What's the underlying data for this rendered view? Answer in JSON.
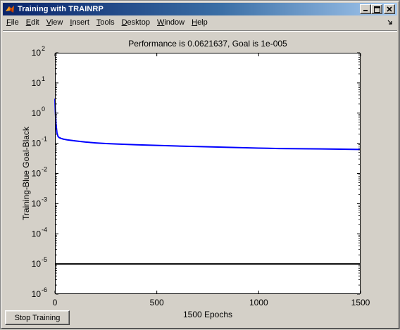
{
  "window": {
    "title": "Training with TRAINRP",
    "controls": [
      "minimize",
      "maximize",
      "close"
    ]
  },
  "menu": {
    "items": [
      {
        "pre": "",
        "ul": "F",
        "post": "ile"
      },
      {
        "pre": "",
        "ul": "E",
        "post": "dit"
      },
      {
        "pre": "",
        "ul": "V",
        "post": "iew"
      },
      {
        "pre": "",
        "ul": "I",
        "post": "nsert"
      },
      {
        "pre": "",
        "ul": "T",
        "post": "ools"
      },
      {
        "pre": "",
        "ul": "D",
        "post": "esktop"
      },
      {
        "pre": "",
        "ul": "W",
        "post": "indow"
      },
      {
        "pre": "",
        "ul": "H",
        "post": "elp"
      }
    ]
  },
  "controls": {
    "stop_label": "Stop Training"
  },
  "chart_data": {
    "type": "line",
    "title": "Performance is 0.0621637, Goal is 1e-005",
    "xlabel": "1500 Epochs",
    "ylabel": "Training-Blue  Goal-Black",
    "xlim": [
      0,
      1500
    ],
    "ylim": [
      1e-06,
      100
    ],
    "yscale": "log",
    "grid": false,
    "x_ticks": [
      0,
      500,
      1000,
      1500
    ],
    "y_ticks": [
      {
        "base": "10",
        "exp": "2",
        "value": 100
      },
      {
        "base": "10",
        "exp": "1",
        "value": 10
      },
      {
        "base": "10",
        "exp": "0",
        "value": 1
      },
      {
        "base": "10",
        "exp": "-1",
        "value": 0.1
      },
      {
        "base": "10",
        "exp": "-2",
        "value": 0.01
      },
      {
        "base": "10",
        "exp": "-3",
        "value": 0.001
      },
      {
        "base": "10",
        "exp": "-4",
        "value": 0.0001
      },
      {
        "base": "10",
        "exp": "-5",
        "value": 1e-05
      },
      {
        "base": "10",
        "exp": "-6",
        "value": 1e-06
      }
    ],
    "series": [
      {
        "color": "#0000ff",
        "x": [
          0,
          2,
          5,
          10,
          15,
          20,
          30,
          40,
          60,
          80,
          100,
          150,
          200,
          250,
          300,
          400,
          500,
          600,
          700,
          800,
          900,
          1000,
          1100,
          1200,
          1300,
          1400,
          1500
        ],
        "y": [
          3.0,
          1.2,
          0.45,
          0.22,
          0.17,
          0.155,
          0.145,
          0.138,
          0.13,
          0.125,
          0.12,
          0.11,
          0.103,
          0.098,
          0.095,
          0.089,
          0.085,
          0.081,
          0.078,
          0.075,
          0.072,
          0.069,
          0.067,
          0.066,
          0.065,
          0.064,
          0.0621637
        ]
      },
      {
        "color": "#000000",
        "x": [
          0,
          1500
        ],
        "y": [
          1e-05,
          1e-05
        ]
      }
    ]
  }
}
